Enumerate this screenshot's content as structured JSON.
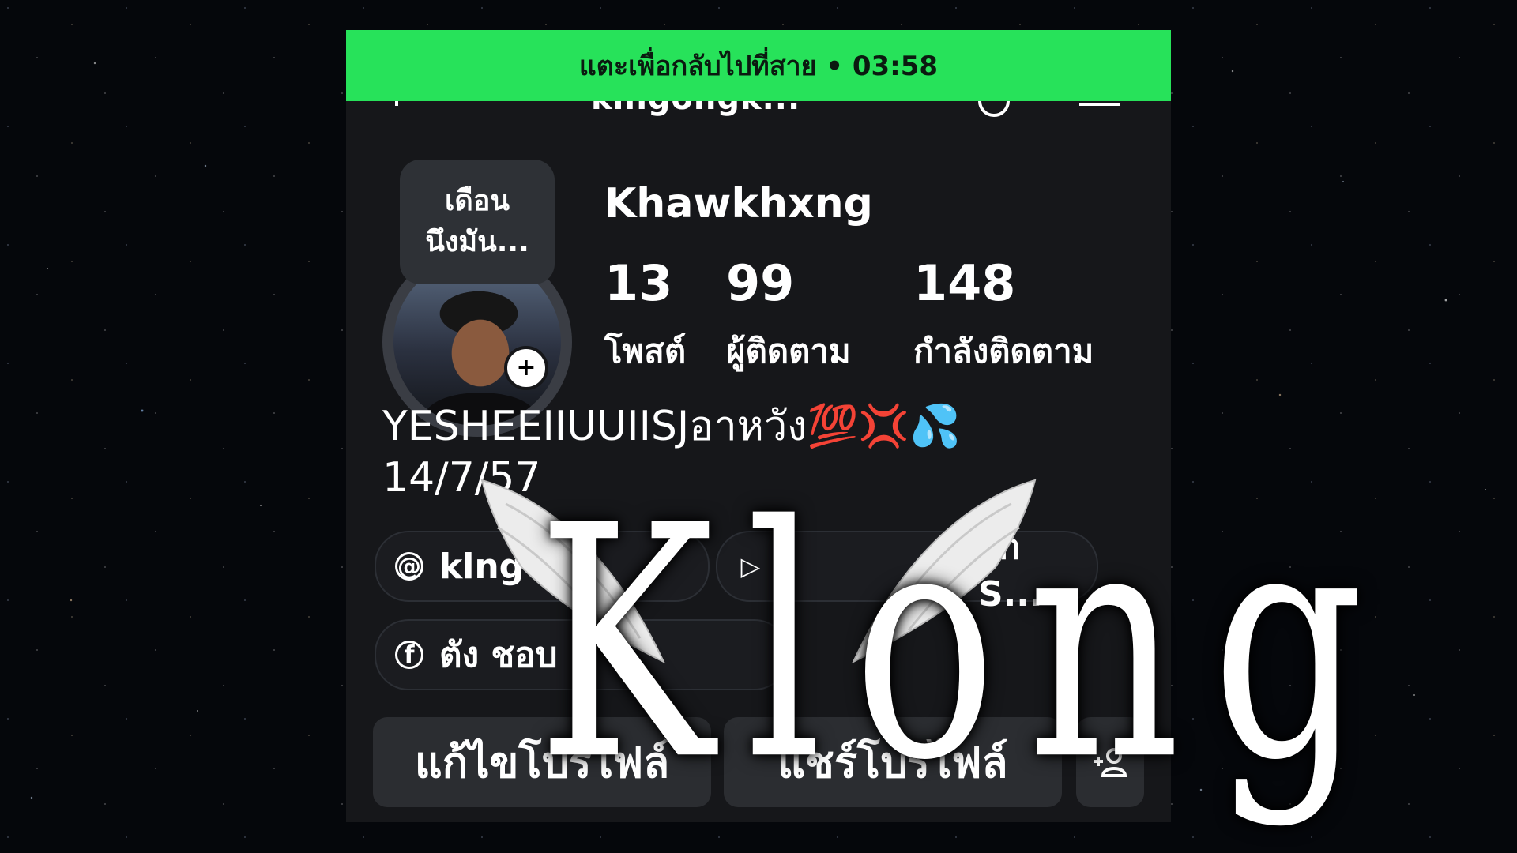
{
  "call_banner": {
    "text": "แตะเพื่อกลับไปที่สาย • 03:58"
  },
  "header": {
    "username_partial": "klngongk..."
  },
  "profile": {
    "note": [
      "เดือน",
      "นึงมัน..."
    ],
    "add_story_symbol": "+",
    "display_name": "Khawkhxng",
    "stats": [
      {
        "value": "13",
        "label": "โพสต์"
      },
      {
        "value": "99",
        "label": "ผู้ติดตาม"
      },
      {
        "value": "148",
        "label": "กำลังติดตาม"
      }
    ],
    "bio_line1_text": "YESHEEIIUUIISJอาหวัง",
    "bio_line1_emojis": [
      "💯",
      "💢",
      "💦"
    ],
    "bio_line2": "14/7/57"
  },
  "links": {
    "threads_chip_text": "klng",
    "music_chip_text": "ฮก S...",
    "facebook_chip_text": "ตัง ชอบ"
  },
  "actions": {
    "edit_profile": "แก้ไขโปรไฟล์",
    "share_profile": "แชร์โปรไฟล์",
    "add_friend_symbol": "+"
  },
  "overlay": {
    "title": "Klong"
  },
  "colors": {
    "call_banner": "#27e25a",
    "screen_bg": "#16171a",
    "button_bg": "#2b2d31"
  }
}
